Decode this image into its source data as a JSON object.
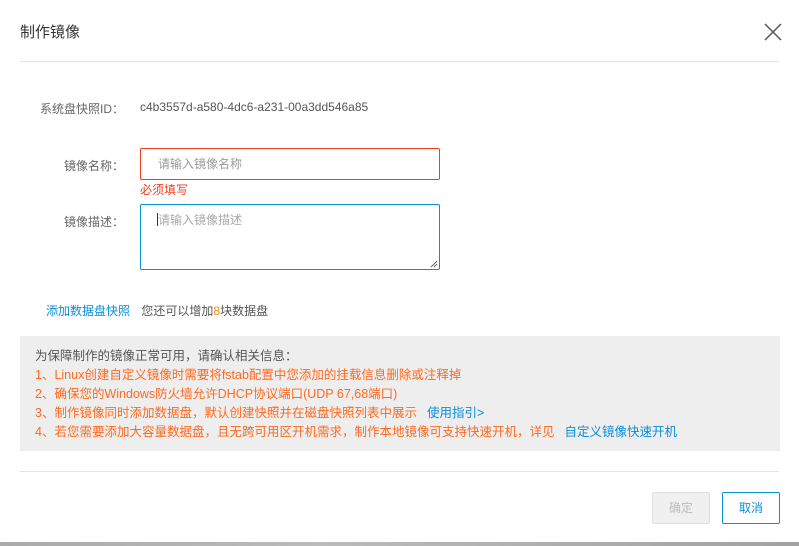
{
  "dialog": {
    "title": "制作镜像",
    "close_icon": "close-icon"
  },
  "form": {
    "snapshot_id_label": "系统盘快照ID：",
    "snapshot_id_value": "c4b3557d-a580-4dc6-a231-00a3dd546a85",
    "name_label": "镜像名称：",
    "name_placeholder": "请输入镜像名称",
    "name_value": "",
    "name_error": "必须填写",
    "desc_label": "镜像描述：",
    "desc_placeholder": "请输入镜像描述",
    "desc_value": ""
  },
  "data_disk": {
    "add_link": "添加数据盘快照",
    "hint_prefix": "您还可以增加",
    "count": "8",
    "hint_suffix": "块数据盘"
  },
  "notice": {
    "heading": "为保障制作的镜像正常可用，请确认相关信息：",
    "items": [
      "1、Linux创建自定义镜像时需要将fstab配置中您添加的挂载信息删除或注释掉",
      "2、确保您的Windows防火墙允许DHCP协议端口(UDP 67,68端口)",
      "3、制作镜像同时添加数据盘，默认创建快照并在磁盘快照列表中展示",
      "4、若您需要添加大容量数据盘，且无跨可用区开机需求，制作本地镜像可支持快速开机，详见"
    ],
    "guide_link": "使用指引>",
    "fast_boot_link": "自定义镜像快速开机"
  },
  "footer": {
    "ok": "确定",
    "cancel": "取消"
  },
  "colors": {
    "accent": "#0a8ed8",
    "error": "#f23c1c",
    "warning": "#ff6a1f"
  }
}
